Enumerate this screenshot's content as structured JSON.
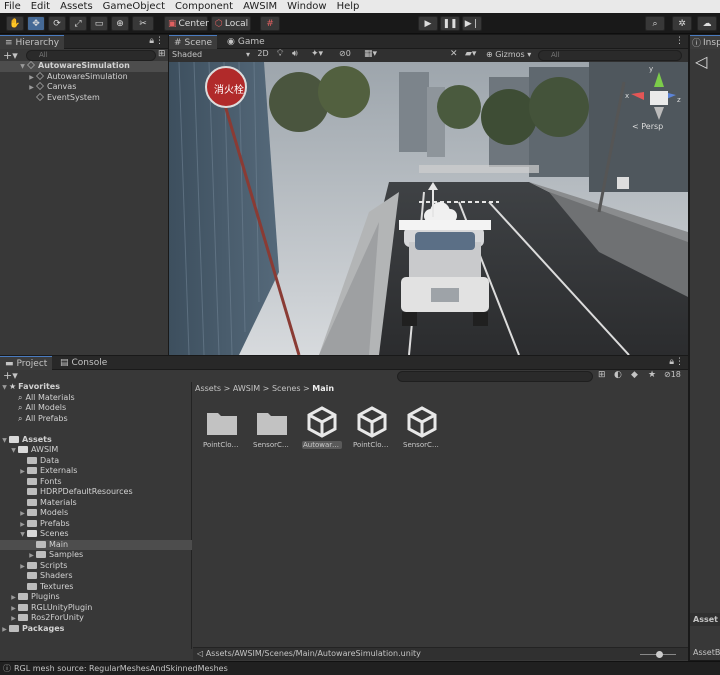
{
  "menu": [
    "File",
    "Edit",
    "Assets",
    "GameObject",
    "Component",
    "AWSIM",
    "Window",
    "Help"
  ],
  "toolbar": {
    "pivot_label": "Center",
    "space_label": "Local"
  },
  "hierarchy": {
    "tab_label": "Hierarchy",
    "search_placeholder": "All",
    "scene_name": "AutowareSimulation",
    "items": [
      "AutowareSimulation",
      "Canvas",
      "EventSystem"
    ]
  },
  "scene_view": {
    "tabs": [
      "Scene",
      "Game"
    ],
    "shading_mode": "Shaded",
    "mode_2d": "2D",
    "hidden_count": "0",
    "gizmos_label": "Gizmos",
    "search_placeholder": "All",
    "persp_label": "< Persp",
    "sign_text": "消火栓",
    "gizmo_axes": {
      "x": "x",
      "y": "y",
      "z": "z"
    }
  },
  "inspector": {
    "tab_label": "Insp",
    "footer_labels": [
      "Asset L",
      "AssetBu"
    ]
  },
  "project": {
    "tabs": [
      "Project",
      "Console"
    ],
    "hidden_count": "18",
    "favorites_label": "Favorites",
    "favorites": [
      "All Materials",
      "All Models",
      "All Prefabs"
    ],
    "tree": [
      {
        "label": "Assets",
        "depth": 0,
        "open": true
      },
      {
        "label": "AWSIM",
        "depth": 1,
        "open": true
      },
      {
        "label": "Data",
        "depth": 2
      },
      {
        "label": "Externals",
        "depth": 2,
        "fold": true
      },
      {
        "label": "Fonts",
        "depth": 2
      },
      {
        "label": "HDRPDefaultResources",
        "depth": 2
      },
      {
        "label": "Materials",
        "depth": 2
      },
      {
        "label": "Models",
        "depth": 2,
        "fold": true
      },
      {
        "label": "Prefabs",
        "depth": 2,
        "fold": true
      },
      {
        "label": "Scenes",
        "depth": 2,
        "open": true
      },
      {
        "label": "Main",
        "depth": 3,
        "selected": true
      },
      {
        "label": "Samples",
        "depth": 3,
        "fold": true
      },
      {
        "label": "Scripts",
        "depth": 2,
        "fold": true
      },
      {
        "label": "Shaders",
        "depth": 2
      },
      {
        "label": "Textures",
        "depth": 2
      },
      {
        "label": "Plugins",
        "depth": 1,
        "fold": true
      },
      {
        "label": "RGLUnityPlugin",
        "depth": 1,
        "fold": true
      },
      {
        "label": "Ros2ForUnity",
        "depth": 1,
        "fold": true
      },
      {
        "label": "Packages",
        "depth": 0,
        "fold": true
      }
    ],
    "breadcrumb": [
      "Assets",
      "AWSIM",
      "Scenes",
      "Main"
    ],
    "assets": [
      {
        "label": "PointClou...",
        "kind": "folder"
      },
      {
        "label": "SensorConf...",
        "kind": "folder"
      },
      {
        "label": "AutowareS...",
        "kind": "unity",
        "selected": true
      },
      {
        "label": "PointClou...",
        "kind": "unity"
      },
      {
        "label": "SensorConf...",
        "kind": "unity"
      }
    ],
    "footer_path": "Assets/AWSIM/Scenes/Main/AutowareSimulation.unity"
  },
  "status_bar": {
    "message": "RGL mesh source: RegularMeshesAndSkinnedMeshes"
  },
  "colors": {
    "accent": "#466a96",
    "selection": "#2c5d87",
    "background": "#383838"
  }
}
